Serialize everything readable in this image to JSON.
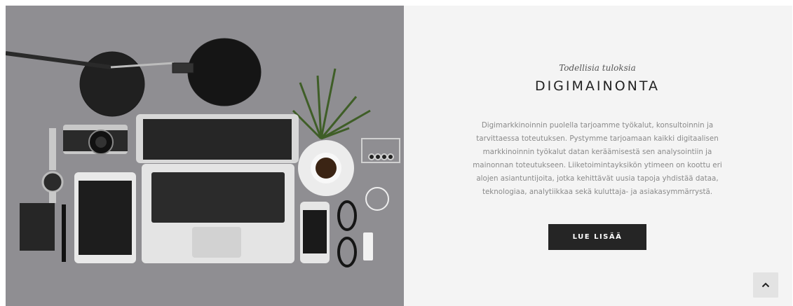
{
  "hero": {
    "image_alt_icon": "desk-workspace-photo",
    "subtitle": "Todellisia tuloksia",
    "title": "DIGIMAINONTA",
    "body": "Digimarkkinoinnin puolella tarjoamme työkalut, konsultoinnin ja tarvittaessa toteutuksen. Pystymme tarjoamaan kaikki digitaalisen markkinoinnin työkalut datan keräämisestä sen analysointiin ja mainonnan toteutukseen. Liiketoimintayksikön ytimeen on koottu eri alojen asiantuntijoita, jotka kehittävät uusia tapoja yhdistää dataa, teknologiaa, analytiikkaa sekä kuluttaja- ja asiakasymmärrystä.",
    "cta_label": "LUE LISÄÄ"
  },
  "scroll_top": {
    "icon": "chevron-up-icon"
  },
  "colors": {
    "panel_bg": "#f4f4f4",
    "button_bg": "#252525",
    "photo_bg": "#8f8e92"
  }
}
